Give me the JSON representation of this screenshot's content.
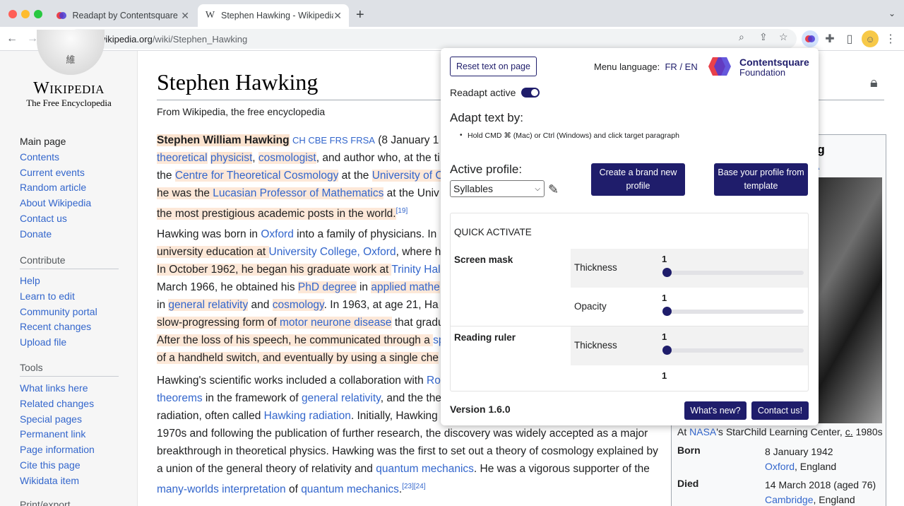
{
  "browser": {
    "tabs": [
      {
        "title": "Readapt by Contentsquare Fou",
        "close": "✕"
      },
      {
        "title": "Stephen Hawking - Wikipedia",
        "close": "✕"
      }
    ],
    "new_tab": "+",
    "url_host": "en.wikipedia.org",
    "url_path": "/wiki/Stephen_Hawking"
  },
  "wiki": {
    "globe_glyph": "維",
    "wordmark": "Wikipedia",
    "tagline": "The Free Encyclopedia",
    "nav_main": [
      "Main page",
      "Contents",
      "Current events",
      "Random article",
      "About Wikipedia",
      "Contact us",
      "Donate"
    ],
    "contribute_title": "Contribute",
    "nav_contribute": [
      "Help",
      "Learn to edit",
      "Community portal",
      "Recent changes",
      "Upload file"
    ],
    "tools_title": "Tools",
    "nav_tools": [
      "What links here",
      "Related changes",
      "Special pages",
      "Permanent link",
      "Page information",
      "Cite this page",
      "Wikidata item"
    ],
    "print_title": "Print/export",
    "title": "Stephen Hawking",
    "from": "From Wikipedia, the free encyclopedia",
    "p1": {
      "name": "Stephen William Hawking",
      "postnominals": "CH CBE FRS FRSA",
      "rest1": " (8 January 1",
      "l2a": "theoretical",
      "l2b": "physicist",
      "l2c": "cosmologist",
      "l2d": ", and author who, at the ti",
      "l3a": "the ",
      "l3b": "Centre for Theoretical Cosmology",
      "l3c": " at the ",
      "l3d": "University of C",
      "l4a": "he was the ",
      "l4b": "Lucasian Professor of Mathematics",
      "l4c": " at the Univ",
      "l5a": "the most prestigious academic posts in the world.",
      "ref": "[19]"
    },
    "p2": {
      "l1a": "Hawking was born in ",
      "l1b": "Oxford",
      "l1c": " into a family of physicians. In",
      "l2a": "university education at ",
      "l2b": "University College, Oxford",
      "l2c": ", where h",
      "l3a": "In October 1962, he began his graduate work at ",
      "l3b": "Trinity Hal",
      "l4a": "March 1966, he obtained his ",
      "l4b": "PhD degree",
      "l4c": " in ",
      "l4d": "applied mathe",
      "l5a": "in ",
      "l5b": "general relativity",
      "l5c": " and ",
      "l5d": "cosmology",
      "l5e": ". In 1963, at age 21, Ha",
      "l6a": "slow-progressing form of ",
      "l6b": "motor neurone disease",
      "l6c": " that gradu",
      "l7a": "After the loss of his speech, he communicated through a ",
      "l7b": "sp",
      "l8a": "of a handheld switch, and eventually by using a single che"
    },
    "p3": {
      "l1a": "Hawking's scientific works included a collaboration with ",
      "l1b": "Ro",
      "l2a": "theorems",
      "l2b": " in the framework of ",
      "l2c": "general relativity",
      "l2d": ", and the the",
      "l3a": "radiation, often called ",
      "l3b": "Hawking radiation",
      "l3c": ". Initially, Hawking",
      "l4": "1970s and following the publication of further research, the discovery was widely accepted as a major",
      "l5": "breakthrough in theoretical physics. Hawking was the first to set out a theory of cosmology explained by",
      "l6a": "a union of the general theory of relativity and ",
      "l6b": "quantum mechanics",
      "l6c": ". He was a vigorous supporter of the",
      "l7a": "many-worlds interpretation",
      "l7b": " of ",
      "l7c": "quantum mechanics",
      "l7d": ".",
      "ref": "[23][24]"
    },
    "infobox": {
      "name_partial": "ng",
      "link_partial": "A",
      "caption_a": "At ",
      "caption_b": "NASA",
      "caption_c": "'s StarChild Learning Center, ",
      "caption_d": "c.",
      "caption_e": " 1980s",
      "born_label": "Born",
      "born_date": "8 January 1942",
      "born_place_a": "Oxford",
      "born_place_b": ", England",
      "died_label": "Died",
      "died_date": "14 March 2018 (aged 76)",
      "died_place_a": "Cambridge",
      "died_place_b": ", England"
    }
  },
  "readapt": {
    "reset_label": "Reset text on page",
    "menu_language_label": "Menu language:",
    "lang_fr": "FR",
    "lang_sep": " / ",
    "lang_en": "EN",
    "logo_line1": "Contentsquare",
    "logo_line2": "Foundation",
    "active_label": "Readapt active",
    "active": true,
    "adapt_title": "Adapt text by:",
    "adapt_hint": "Hold CMD ⌘ (Mac) or Ctrl (Windows) and click target paragraph",
    "profile_title": "Active profile:",
    "profile_selected": "Syllables",
    "create_profile_label": "Create a brand new profile",
    "template_profile_label": "Base your profile from template",
    "quick_activate_title": "QUICK ACTIVATE",
    "screen_mask_label": "Screen mask",
    "reading_ruler_label": "Reading ruler",
    "thickness_label": "Thickness",
    "opacity_label": "Opacity",
    "mask_thickness": "1",
    "mask_opacity": "1",
    "ruler_thickness": "1",
    "ruler_extra": "1",
    "version": "Version 1.6.0",
    "whats_new_label": "What's new?",
    "contact_label": "Contact us!"
  }
}
